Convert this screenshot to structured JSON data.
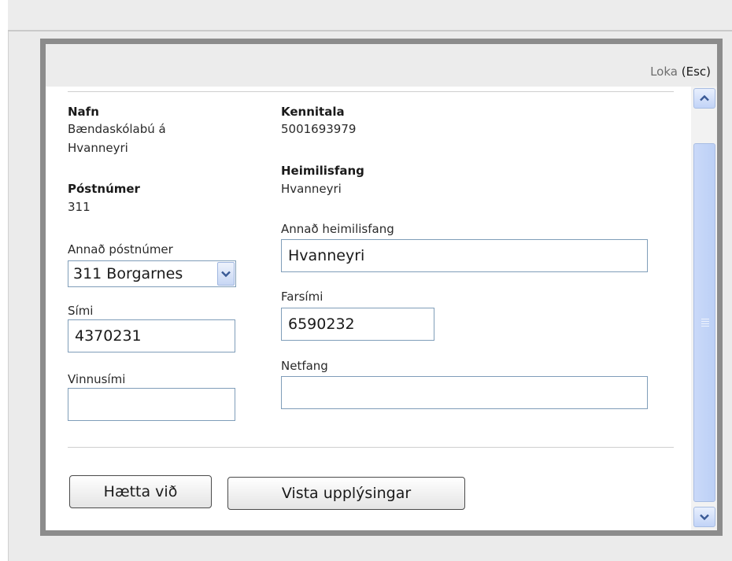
{
  "dialog": {
    "close_label": "Loka",
    "close_key": "(Esc)"
  },
  "form": {
    "name_label": "Nafn",
    "name_value_line1": "Bændaskólabú á",
    "name_value_line2": "Hvanneyri",
    "kennitala_label": "Kennitala",
    "kennitala_value": "5001693979",
    "address_label": "Heimilisfang",
    "address_value": "Hvanneyri",
    "postal_label": "Póstnúmer",
    "postal_value": "311",
    "other_address_label": "Annað heimilisfang",
    "other_address_value": "Hvanneyri",
    "other_postal_label": "Annað póstnúmer",
    "other_postal_selected": "311 Borgarnes",
    "mobile_label": "Farsími",
    "mobile_value": "6590232",
    "phone_label": "Sími",
    "phone_value": "4370231",
    "email_label": "Netfang",
    "email_value": "",
    "work_phone_label": "Vinnusími",
    "work_phone_value": ""
  },
  "buttons": {
    "cancel_label": "Hætta við",
    "save_label": "Vista upplýsingar"
  },
  "icons": {
    "dropdown": "chevron-down-icon",
    "scroll_up": "arrow-up-icon",
    "scroll_down": "arrow-down-icon"
  },
  "colors": {
    "frame": "#8c8c8c",
    "input_border": "#7f9db9",
    "scroll_accent": "#c1d3f7"
  }
}
